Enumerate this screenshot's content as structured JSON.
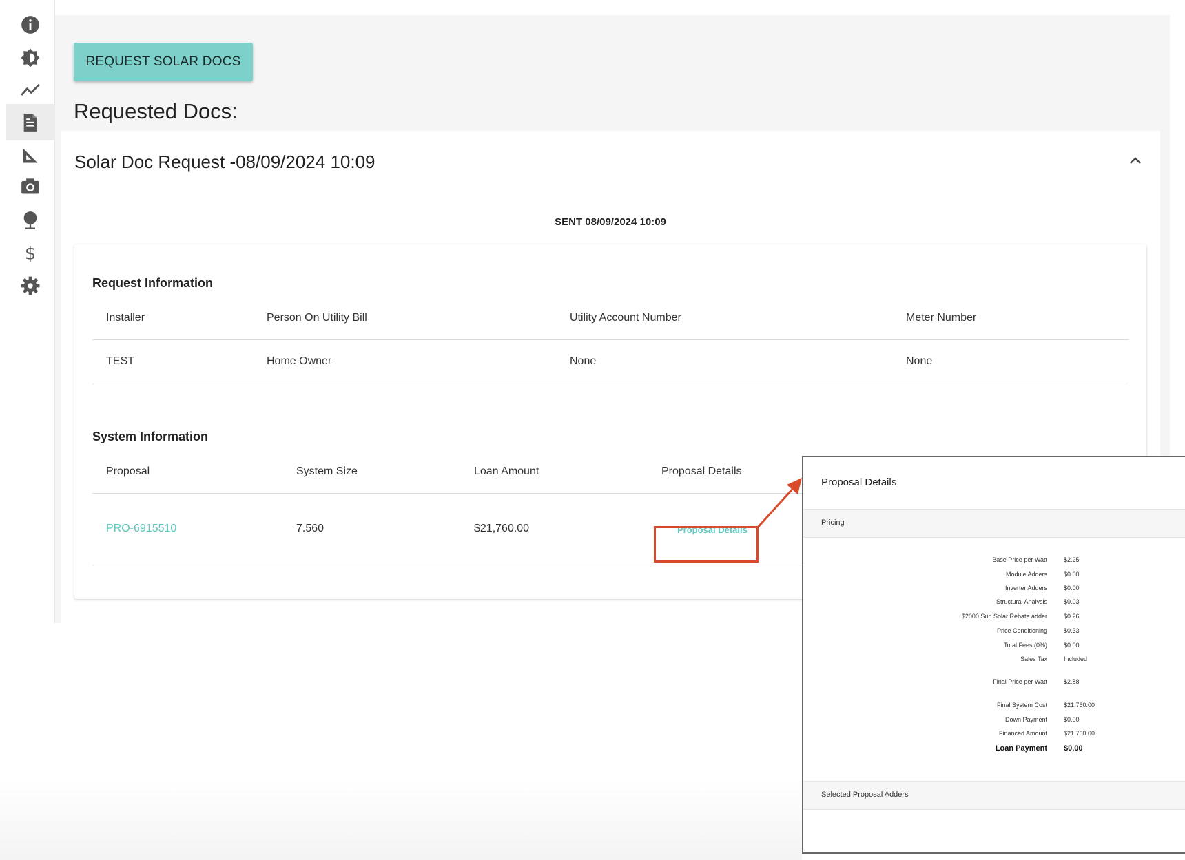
{
  "sidebar": {
    "items": [
      {
        "icon": "info-icon"
      },
      {
        "icon": "brightness-icon"
      },
      {
        "icon": "trend-line-icon"
      },
      {
        "icon": "document-icon",
        "active": true
      },
      {
        "icon": "ruler-triangle-icon"
      },
      {
        "icon": "camera-icon"
      },
      {
        "icon": "tree-icon"
      },
      {
        "icon": "dollar-icon"
      },
      {
        "icon": "gear-icon"
      }
    ]
  },
  "main": {
    "request_button": "REQUEST SOLAR DOCS",
    "requested_title": "Requested Docs:",
    "card": {
      "title": "Solar Doc Request -08/09/2024 10:09",
      "sent": "SENT 08/09/2024 10:09",
      "request_info": {
        "title": "Request Information",
        "headers": [
          "Installer",
          "Person On Utility Bill",
          "Utility Account Number",
          "Meter Number"
        ],
        "row": [
          "TEST",
          "Home Owner",
          "None",
          "None"
        ]
      },
      "system_info": {
        "title": "System Information",
        "headers": [
          "Proposal",
          "System Size",
          "Loan Amount",
          "Proposal Details"
        ],
        "row": {
          "proposal": "PRO-6915510",
          "system_size": "7.560",
          "loan_amount": "$21,760.00",
          "details_link": "Proposal Details"
        }
      }
    }
  },
  "popup": {
    "title": "Proposal Details",
    "pricing_label": "Pricing",
    "pricing_rows": [
      {
        "label": "Base Price per Watt",
        "value": "$2.25"
      },
      {
        "label": "Module Adders",
        "value": "$0.00"
      },
      {
        "label": "Inverter Adders",
        "value": "$0.00"
      },
      {
        "label": "Structural Analysis",
        "value": "$0.03"
      },
      {
        "label": "$2000 Sun Solar Rebate adder",
        "value": "$0.26"
      },
      {
        "label": "Price Conditioning",
        "value": "$0.33"
      },
      {
        "label": "Total Fees (0%)",
        "value": "$0.00"
      },
      {
        "label": "Sales Tax",
        "value": "Included"
      },
      {
        "label": "Final Price per Watt",
        "value": "$2.88"
      },
      {
        "label": "Final System Cost",
        "value": "$21,760.00"
      },
      {
        "label": "Down Payment",
        "value": "$0.00"
      },
      {
        "label": "Financed Amount",
        "value": "$21,760.00"
      },
      {
        "label": "Loan Payment",
        "value": "$0.00"
      }
    ],
    "adders_label": "Selected Proposal Adders"
  },
  "colors": {
    "accent": "#7ed1ca",
    "link": "#5cc7bd",
    "highlight": "#d94a2b"
  }
}
